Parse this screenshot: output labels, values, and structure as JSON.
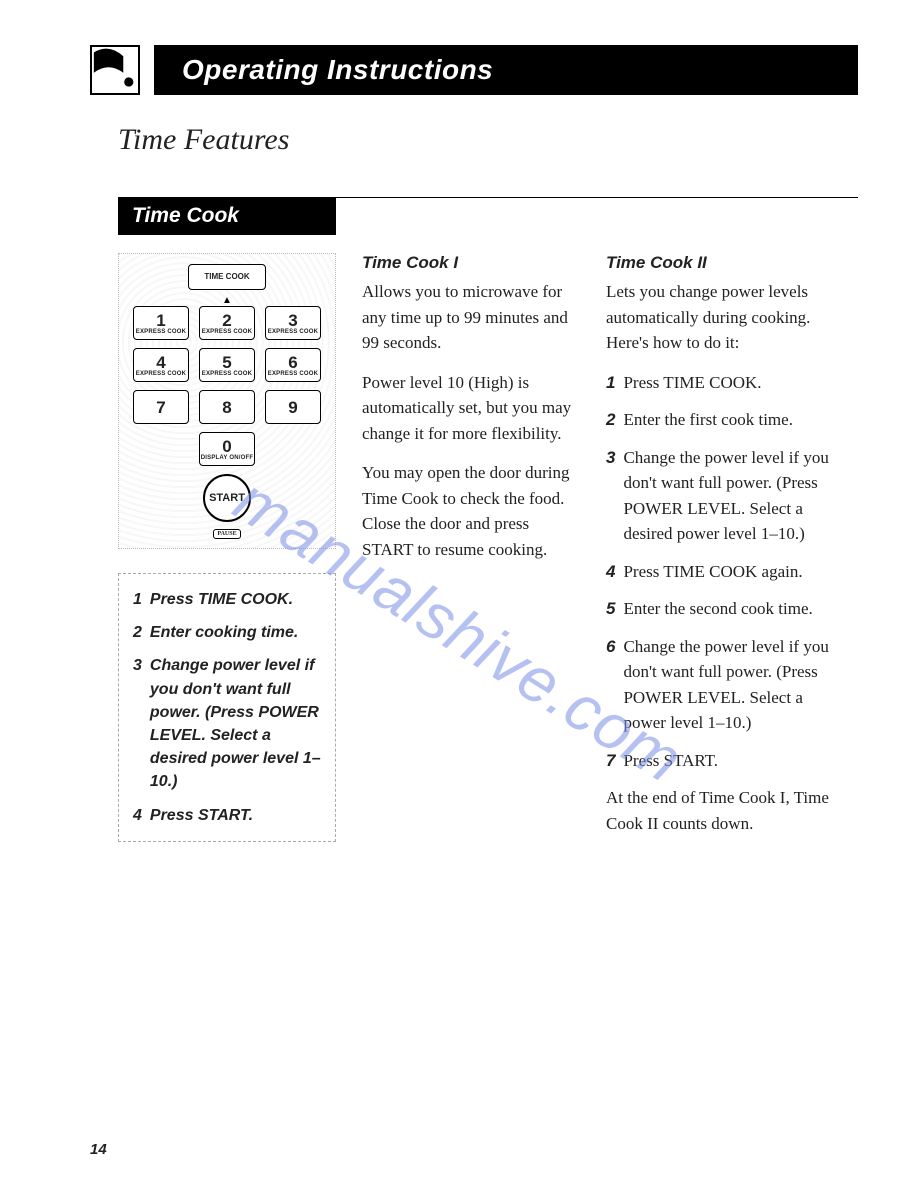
{
  "header": {
    "title": "Operating Instructions"
  },
  "subtitle": "Time Features",
  "section_label": "Time Cook",
  "keypad": {
    "time_cook": "TIME COOK",
    "express": "EXPRESS COOK",
    "display": "DISPLAY ON/OFF",
    "start": "START",
    "pause": "PAUSE",
    "digits": [
      "1",
      "2",
      "3",
      "4",
      "5",
      "6",
      "7",
      "8",
      "9",
      "0"
    ]
  },
  "steps_box": [
    {
      "n": "1",
      "t": "Press TIME COOK."
    },
    {
      "n": "2",
      "t": "Enter cooking time."
    },
    {
      "n": "3",
      "t": "Change power level if you don't want full power. (Press POWER LEVEL. Select a desired power level 1–10.)"
    },
    {
      "n": "4",
      "t": "Press START."
    }
  ],
  "mid": {
    "heading": "Time Cook I",
    "p1": "Allows you to microwave for any time up to 99 minutes and 99 seconds.",
    "p2": "Power level 10 (High) is automatically set, but you may change it for more flexibility.",
    "p3": "You may open the door during Time Cook to check the food. Close the door and press START to resume cooking."
  },
  "right": {
    "heading": "Time Cook II",
    "intro": "Lets you change power levels automatically during cooking. Here's how to do it:",
    "list": [
      {
        "n": "1",
        "t": "Press TIME COOK."
      },
      {
        "n": "2",
        "t": "Enter the first cook time."
      },
      {
        "n": "3",
        "t": "Change the power level if you don't want full power. (Press POWER LEVEL. Select a desired power level 1–10.)"
      },
      {
        "n": "4",
        "t": "Press TIME COOK again."
      },
      {
        "n": "5",
        "t": "Enter the second cook time."
      },
      {
        "n": "6",
        "t": "Change the power level if you don't want full power. (Press POWER LEVEL. Select a power level 1–10.)"
      },
      {
        "n": "7",
        "t": "Press START."
      }
    ],
    "outro": "At the end of Time Cook I, Time Cook II counts down."
  },
  "page_number": "14",
  "watermark": "manualshive.com"
}
